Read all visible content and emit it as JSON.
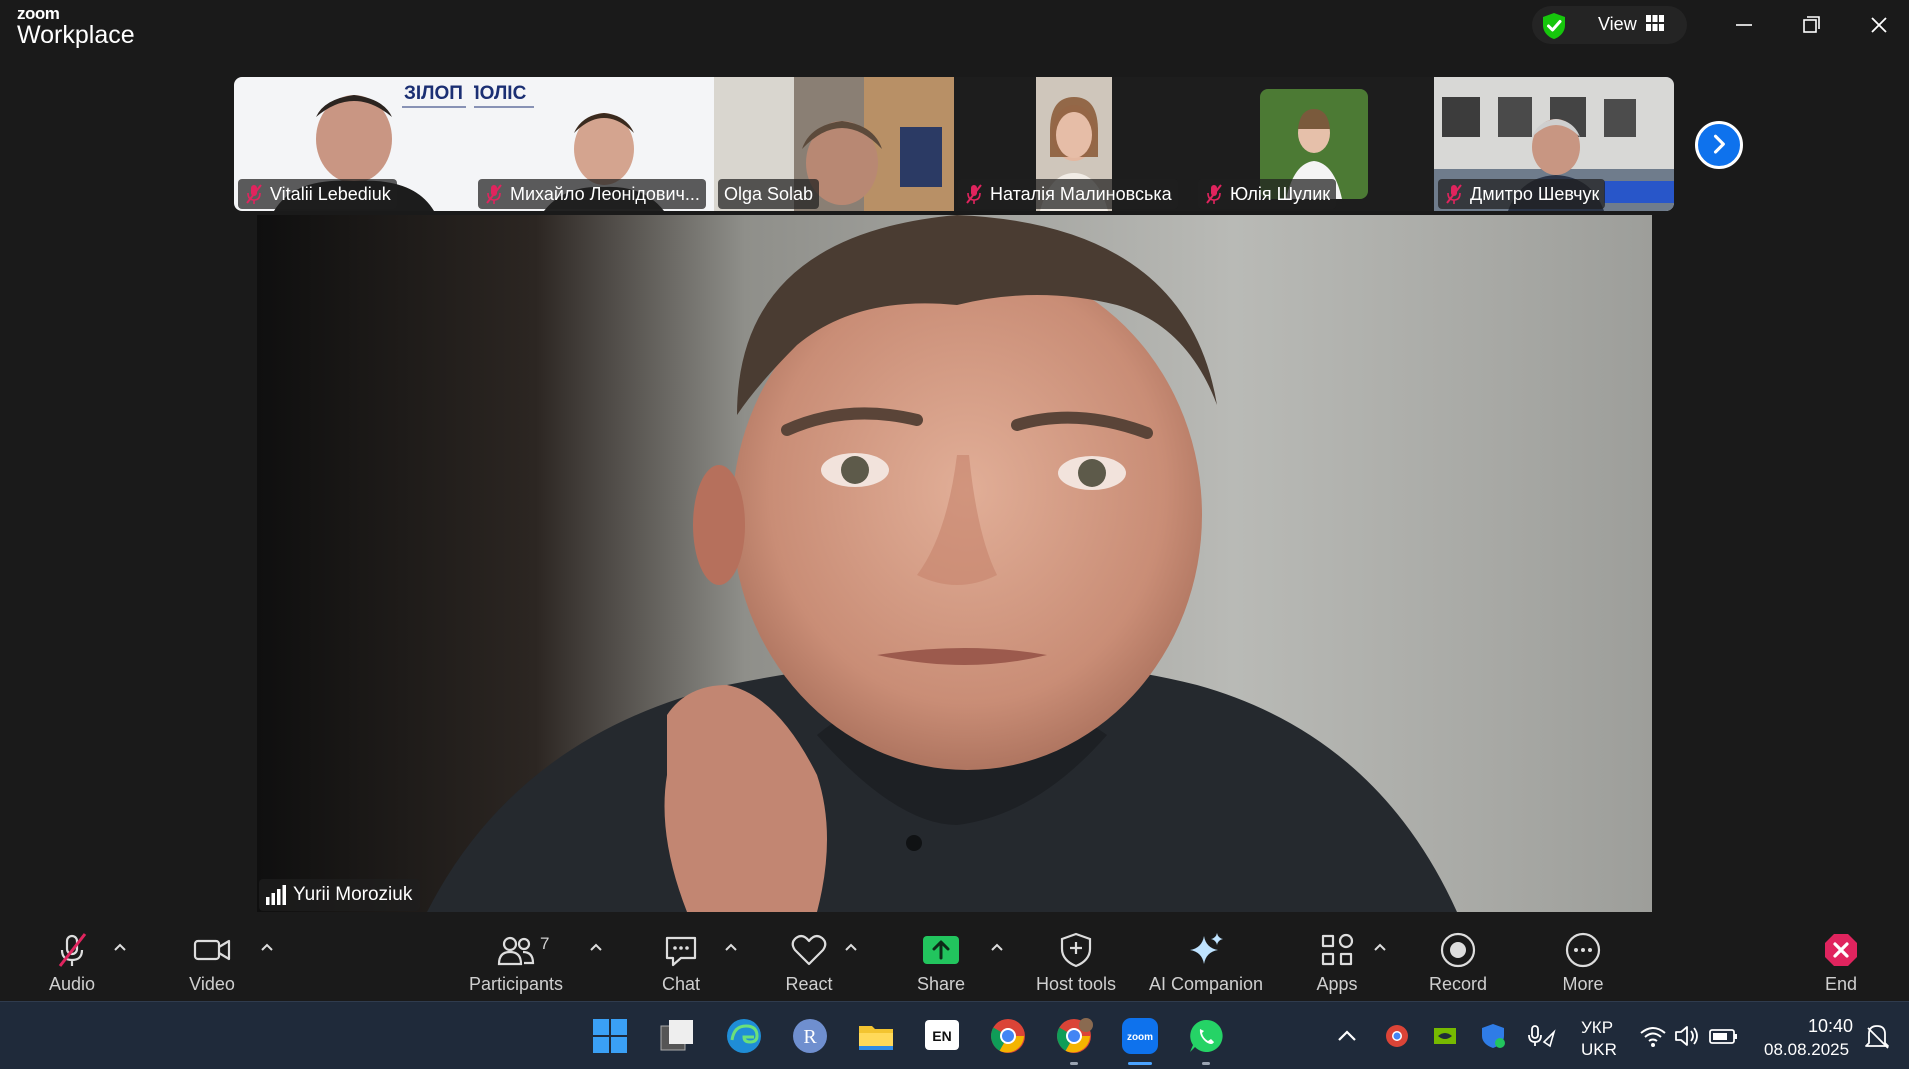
{
  "window": {
    "brand_small": "zoom",
    "brand_large": "Workplace",
    "view_label": "View"
  },
  "participants_strip": [
    {
      "name": "Vitalii Lebediuk",
      "muted": true
    },
    {
      "name": "Михайло Леонідович...",
      "muted": true
    },
    {
      "name": "Olga Solab",
      "muted": false
    },
    {
      "name": "Наталія Малиновська",
      "muted": true
    },
    {
      "name": "Юлія Шулик",
      "muted": true
    },
    {
      "name": "Дмитро Шевчук",
      "muted": true
    }
  ],
  "banner_text": {
    "left": "ЗІЛОП",
    "right": "ПОЛІС"
  },
  "active_speaker": {
    "name": "Yurii Moroziuk"
  },
  "toolbar": {
    "audio": "Audio",
    "video": "Video",
    "participants": "Participants",
    "participants_count": "7",
    "chat": "Chat",
    "react": "React",
    "share": "Share",
    "host_tools": "Host tools",
    "ai_companion": "AI Companion",
    "apps": "Apps",
    "record": "Record",
    "more": "More",
    "end": "End"
  },
  "taskbar": {
    "lang_top": "УКР",
    "lang_bottom": "UKR",
    "time": "10:40",
    "date": "08.08.2025",
    "en_badge": "EN",
    "r_badge": "R",
    "zoom_badge": "zoom"
  },
  "colors": {
    "accent_blue": "#0e72ed",
    "share_green": "#22c55e",
    "mute_red": "#e0245e",
    "end_red": "#e0245e",
    "shield_green": "#16c60c"
  }
}
